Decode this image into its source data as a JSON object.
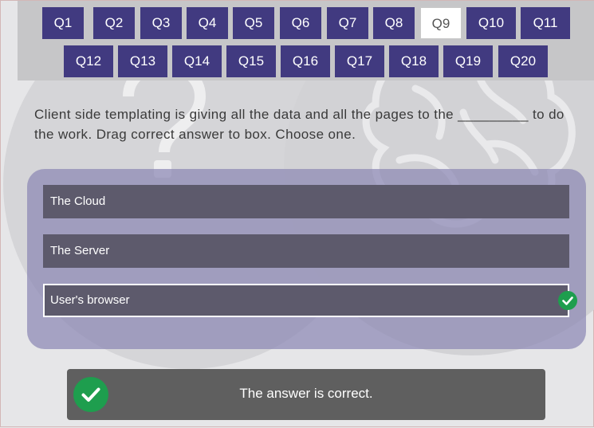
{
  "questions": [
    "Q1",
    "Q2",
    "Q3",
    "Q4",
    "Q5",
    "Q6",
    "Q7",
    "Q8",
    "Q9",
    "Q10",
    "Q11",
    "Q12",
    "Q13",
    "Q14",
    "Q15",
    "Q16",
    "Q17",
    "Q18",
    "Q19",
    "Q20"
  ],
  "active_question": "Q9",
  "question_text": "Client side templating is giving all the data and all the pages to the _________ to do the work. Drag correct answer to box. Choose one.",
  "options": [
    "The Cloud",
    "The Server",
    "User's browser"
  ],
  "selected_option": "User's browser",
  "feedback": {
    "text": "The answer is correct."
  },
  "colors": {
    "nav_button": "#413a80",
    "correct": "#1e9e4e",
    "option": "#5d5a6c",
    "panel": "#8c88b4",
    "feedback": "#5f5f5f"
  }
}
